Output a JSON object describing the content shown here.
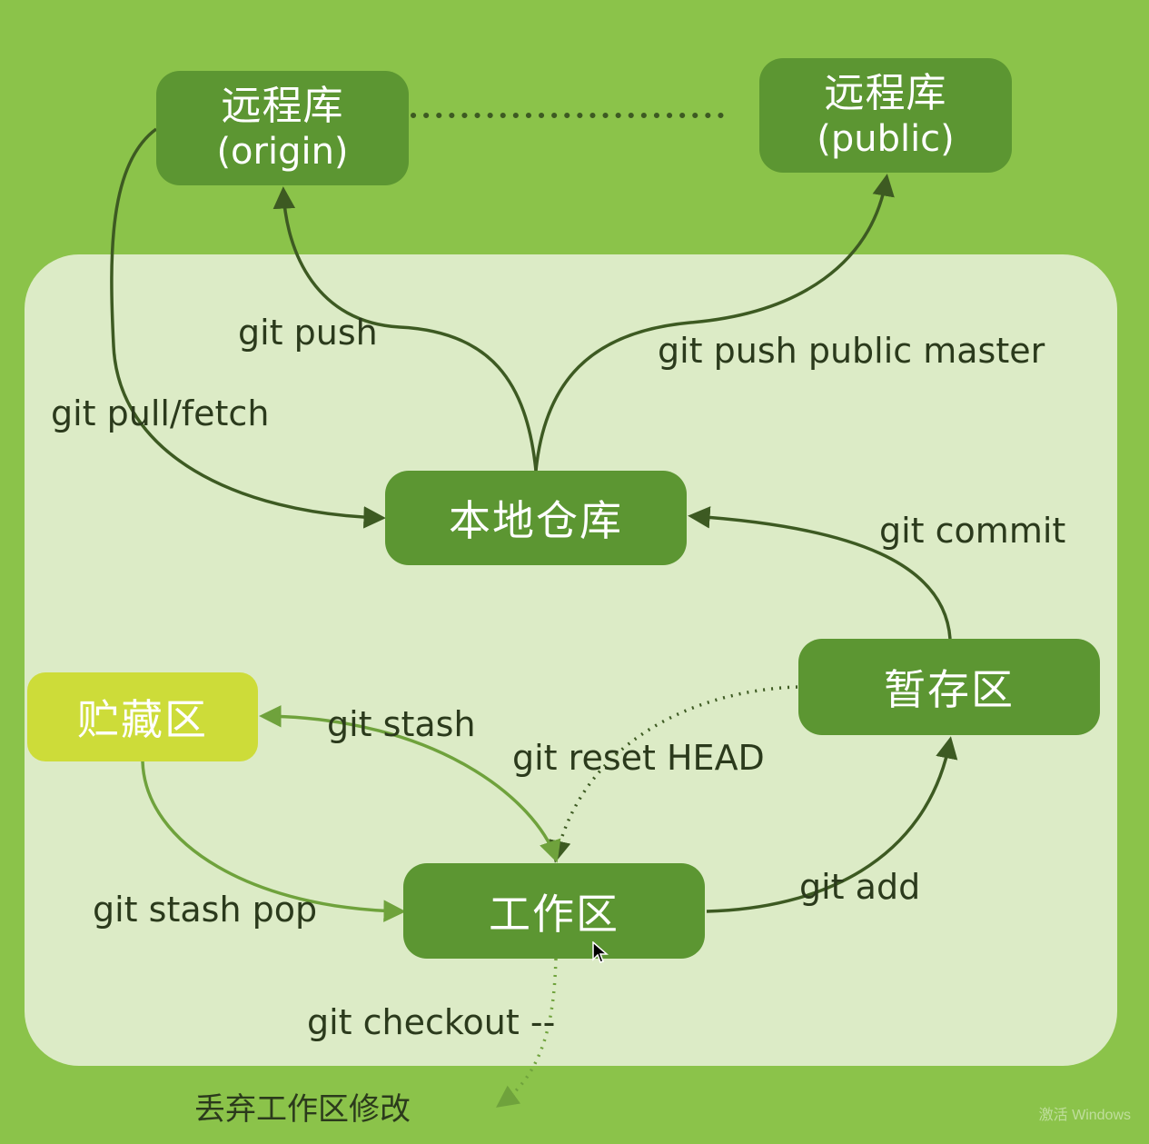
{
  "nodes": {
    "origin": {
      "title": "远程库",
      "sub": "(origin)"
    },
    "public": {
      "title": "远程库",
      "sub": "(public)"
    },
    "local": {
      "title": "本地仓库"
    },
    "stage": {
      "title": "暂存区"
    },
    "stash": {
      "title": "贮藏区"
    },
    "work": {
      "title": "工作区"
    }
  },
  "edges": {
    "push": "git push",
    "pull_fetch": "git pull/fetch",
    "push_public": "git push public master",
    "commit": "git commit",
    "stash": "git stash",
    "reset": "git reset HEAD",
    "stash_pop": "git stash pop",
    "add": "git add",
    "checkout": "git checkout --"
  },
  "notes": {
    "discard": "丢弃工作区修改"
  },
  "watermark": "激活 Windows",
  "colors": {
    "background": "#8bc34a",
    "panel": "#dcebc6",
    "node": "#5c9632",
    "stash_node": "#cddc39",
    "edge": "#3d5a22",
    "stash_edge": "#6fa23c"
  }
}
